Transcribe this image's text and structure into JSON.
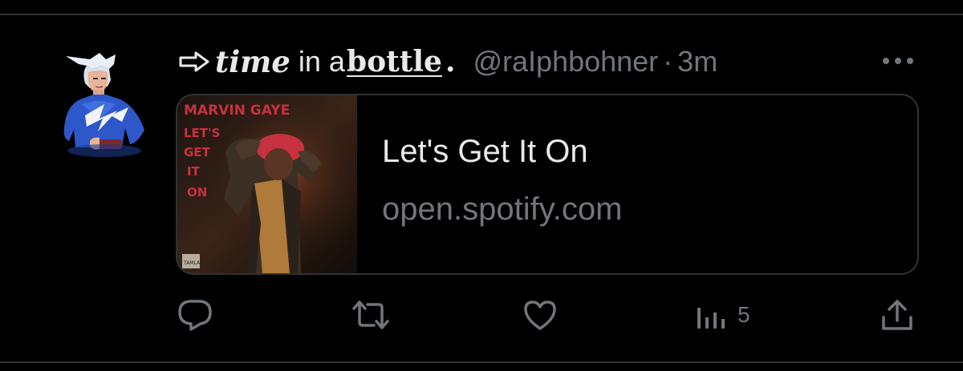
{
  "tweet": {
    "author": {
      "name_part1": "time",
      "name_part2": "in a",
      "name_part3": "bottle",
      "name_part4": ".",
      "handle": "@raIphbohner",
      "separator": "·",
      "time": "3m"
    },
    "card": {
      "album_text_1": "MARVIN GAYE",
      "album_text_2": "LET'S",
      "album_text_3": "GET",
      "album_text_4": "IT",
      "album_text_5": "ON",
      "album_label": "TAMLA",
      "title": "Let's Get It On",
      "domain": "open.spotify.com"
    },
    "actions": {
      "views_count": "5"
    }
  },
  "icons": {
    "reply": "reply-icon",
    "retweet": "retweet-icon",
    "like": "heart-icon",
    "views": "views-chart-icon",
    "share": "share-icon",
    "more": "more-icon",
    "arrow": "arrow-emoji-icon"
  },
  "colors": {
    "background": "#000000",
    "primary_text": "#e7e9ea",
    "secondary_text": "#71767b",
    "border": "#2f3336",
    "album_red": "#c8313f"
  }
}
